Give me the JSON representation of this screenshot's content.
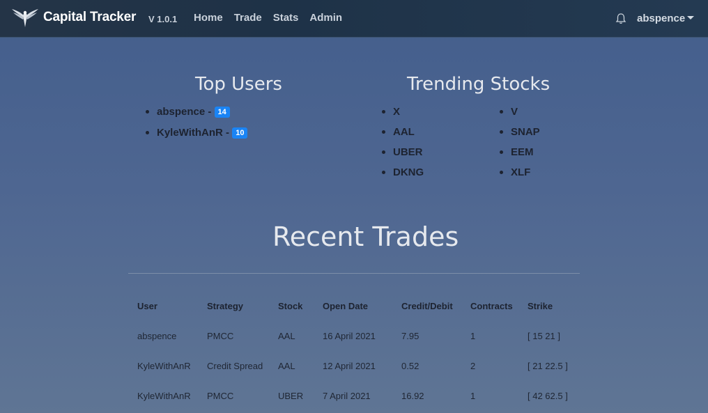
{
  "navbar": {
    "brand_name": "Capital Tracker",
    "version": "V 1.0.1",
    "links": [
      "Home",
      "Trade",
      "Stats",
      "Admin"
    ],
    "username": "abspence"
  },
  "top_users": {
    "title": "Top Users",
    "users": [
      {
        "name": "abspence",
        "separator": "-",
        "count": "14"
      },
      {
        "name": "KyleWithAnR",
        "separator": "-",
        "count": "10"
      }
    ]
  },
  "trending_stocks": {
    "title": "Trending Stocks",
    "column1": [
      "X",
      "AAL",
      "UBER",
      "DKNG"
    ],
    "column2": [
      "V",
      "SNAP",
      "EEM",
      "XLF"
    ]
  },
  "recent_trades": {
    "title": "Recent Trades",
    "headers": [
      "User",
      "Strategy",
      "Stock",
      "Open Date",
      "Credit/Debit",
      "Contracts",
      "Strike"
    ],
    "rows": [
      [
        "abspence",
        "PMCC",
        "AAL",
        "16 April 2021",
        "7.95",
        "1",
        "[ 15 21 ]"
      ],
      [
        "KyleWithAnR",
        "Credit Spread",
        "AAL",
        "12 April 2021",
        "0.52",
        "2",
        "[ 21 22.5 ]"
      ],
      [
        "KyleWithAnR",
        "PMCC",
        "UBER",
        "7 April 2021",
        "16.92",
        "1",
        "[ 42 62.5 ]"
      ]
    ]
  },
  "colors": {
    "badge": "#1a84f5",
    "navbar": "#1e3247"
  }
}
